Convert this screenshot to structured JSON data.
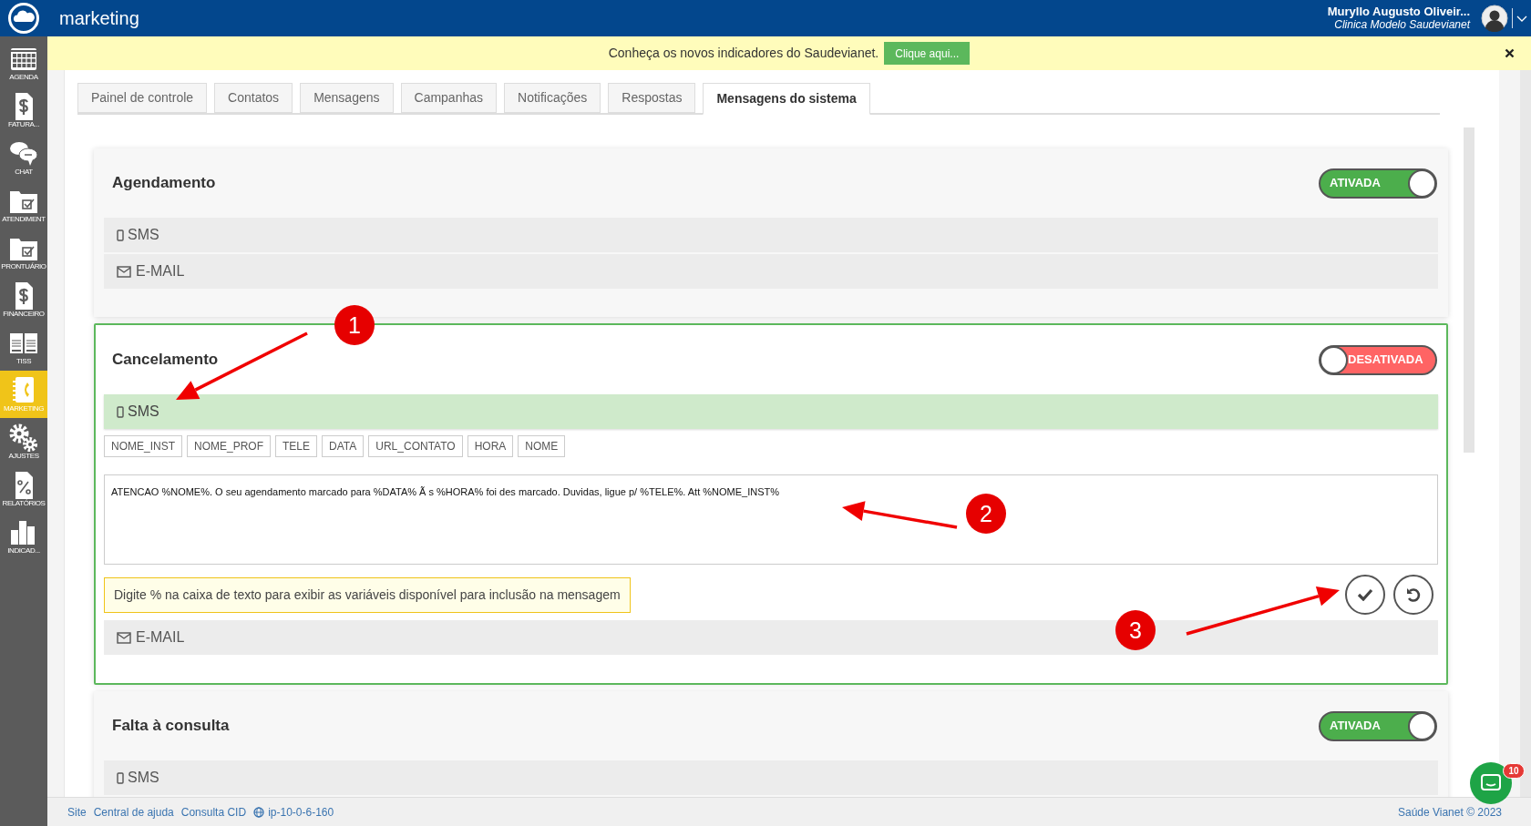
{
  "header": {
    "title": "marketing",
    "user_name": "Muryllo Augusto Oliveir...",
    "organization": "Clinica Modelo Saudevianet"
  },
  "sidebar": {
    "items": [
      {
        "label": "AGENDA",
        "selected": false
      },
      {
        "label": "FATURA...",
        "selected": false
      },
      {
        "label": "CHAT",
        "selected": false
      },
      {
        "label": "ATENDIMENT",
        "selected": false
      },
      {
        "label": "PRONTUÁRIO",
        "selected": false
      },
      {
        "label": "FINANCEIRO",
        "selected": false
      },
      {
        "label": "TISS",
        "selected": false
      },
      {
        "label": "MARKETING",
        "selected": true
      },
      {
        "label": "AJUSTES",
        "selected": false
      },
      {
        "label": "RELATÓRIOS",
        "selected": false
      },
      {
        "label": "INDICAD...",
        "selected": false
      }
    ]
  },
  "banner": {
    "text": "Conheça os novos indicadores do Saudevianet.",
    "button": "Clique aqui..."
  },
  "tabs": [
    {
      "label": "Painel de controle",
      "selected": false
    },
    {
      "label": "Contatos",
      "selected": false
    },
    {
      "label": "Mensagens",
      "selected": false
    },
    {
      "label": "Campanhas",
      "selected": false
    },
    {
      "label": "Notificações",
      "selected": false
    },
    {
      "label": "Respostas",
      "selected": false
    },
    {
      "label": "Mensagens do sistema",
      "selected": true
    }
  ],
  "sections": [
    {
      "title": "Agendamento",
      "selected": false,
      "toggle": {
        "on": true,
        "label": "ATIVADA"
      },
      "channels": [
        {
          "kind": "sms",
          "label": "SMS",
          "expanded": false
        },
        {
          "kind": "email",
          "label": "E-MAIL",
          "expanded": false
        }
      ]
    },
    {
      "title": "Cancelamento",
      "selected": true,
      "toggle": {
        "on": false,
        "label": "DESATIVADA"
      },
      "channels": [
        {
          "kind": "sms",
          "label": "SMS",
          "expanded": true,
          "editor": {
            "variables": [
              "NOME_INST",
              "NOME_PROF",
              "TELE",
              "DATA",
              "URL_CONTATO",
              "HORA",
              "NOME"
            ],
            "message": "ATENCAO %NOME%. O seu agendamento marcado para %DATA% Ã s %HORA% foi des marcado. Duvidas, ligue p/ %TELE%. Att %NOME_INST%",
            "hint": "Digite % na caixa de texto para exibir as variáveis disponível para inclusão na mensagem"
          }
        },
        {
          "kind": "email",
          "label": "E-MAIL",
          "expanded": false
        }
      ]
    },
    {
      "title": "Falta à consulta",
      "selected": false,
      "toggle": {
        "on": true,
        "label": "ATIVADA"
      },
      "channels": [
        {
          "kind": "sms",
          "label": "SMS",
          "expanded": false
        }
      ]
    }
  ],
  "annotations": [
    {
      "label": "1"
    },
    {
      "label": "2"
    },
    {
      "label": "3"
    }
  ],
  "footer": {
    "links": [
      "Site",
      "Central de ajuda",
      "Consulta CID"
    ],
    "server": "ip-10-0-6-160",
    "copyright": "Saúde Vianet © 2023"
  },
  "chat": {
    "badge": "10"
  }
}
